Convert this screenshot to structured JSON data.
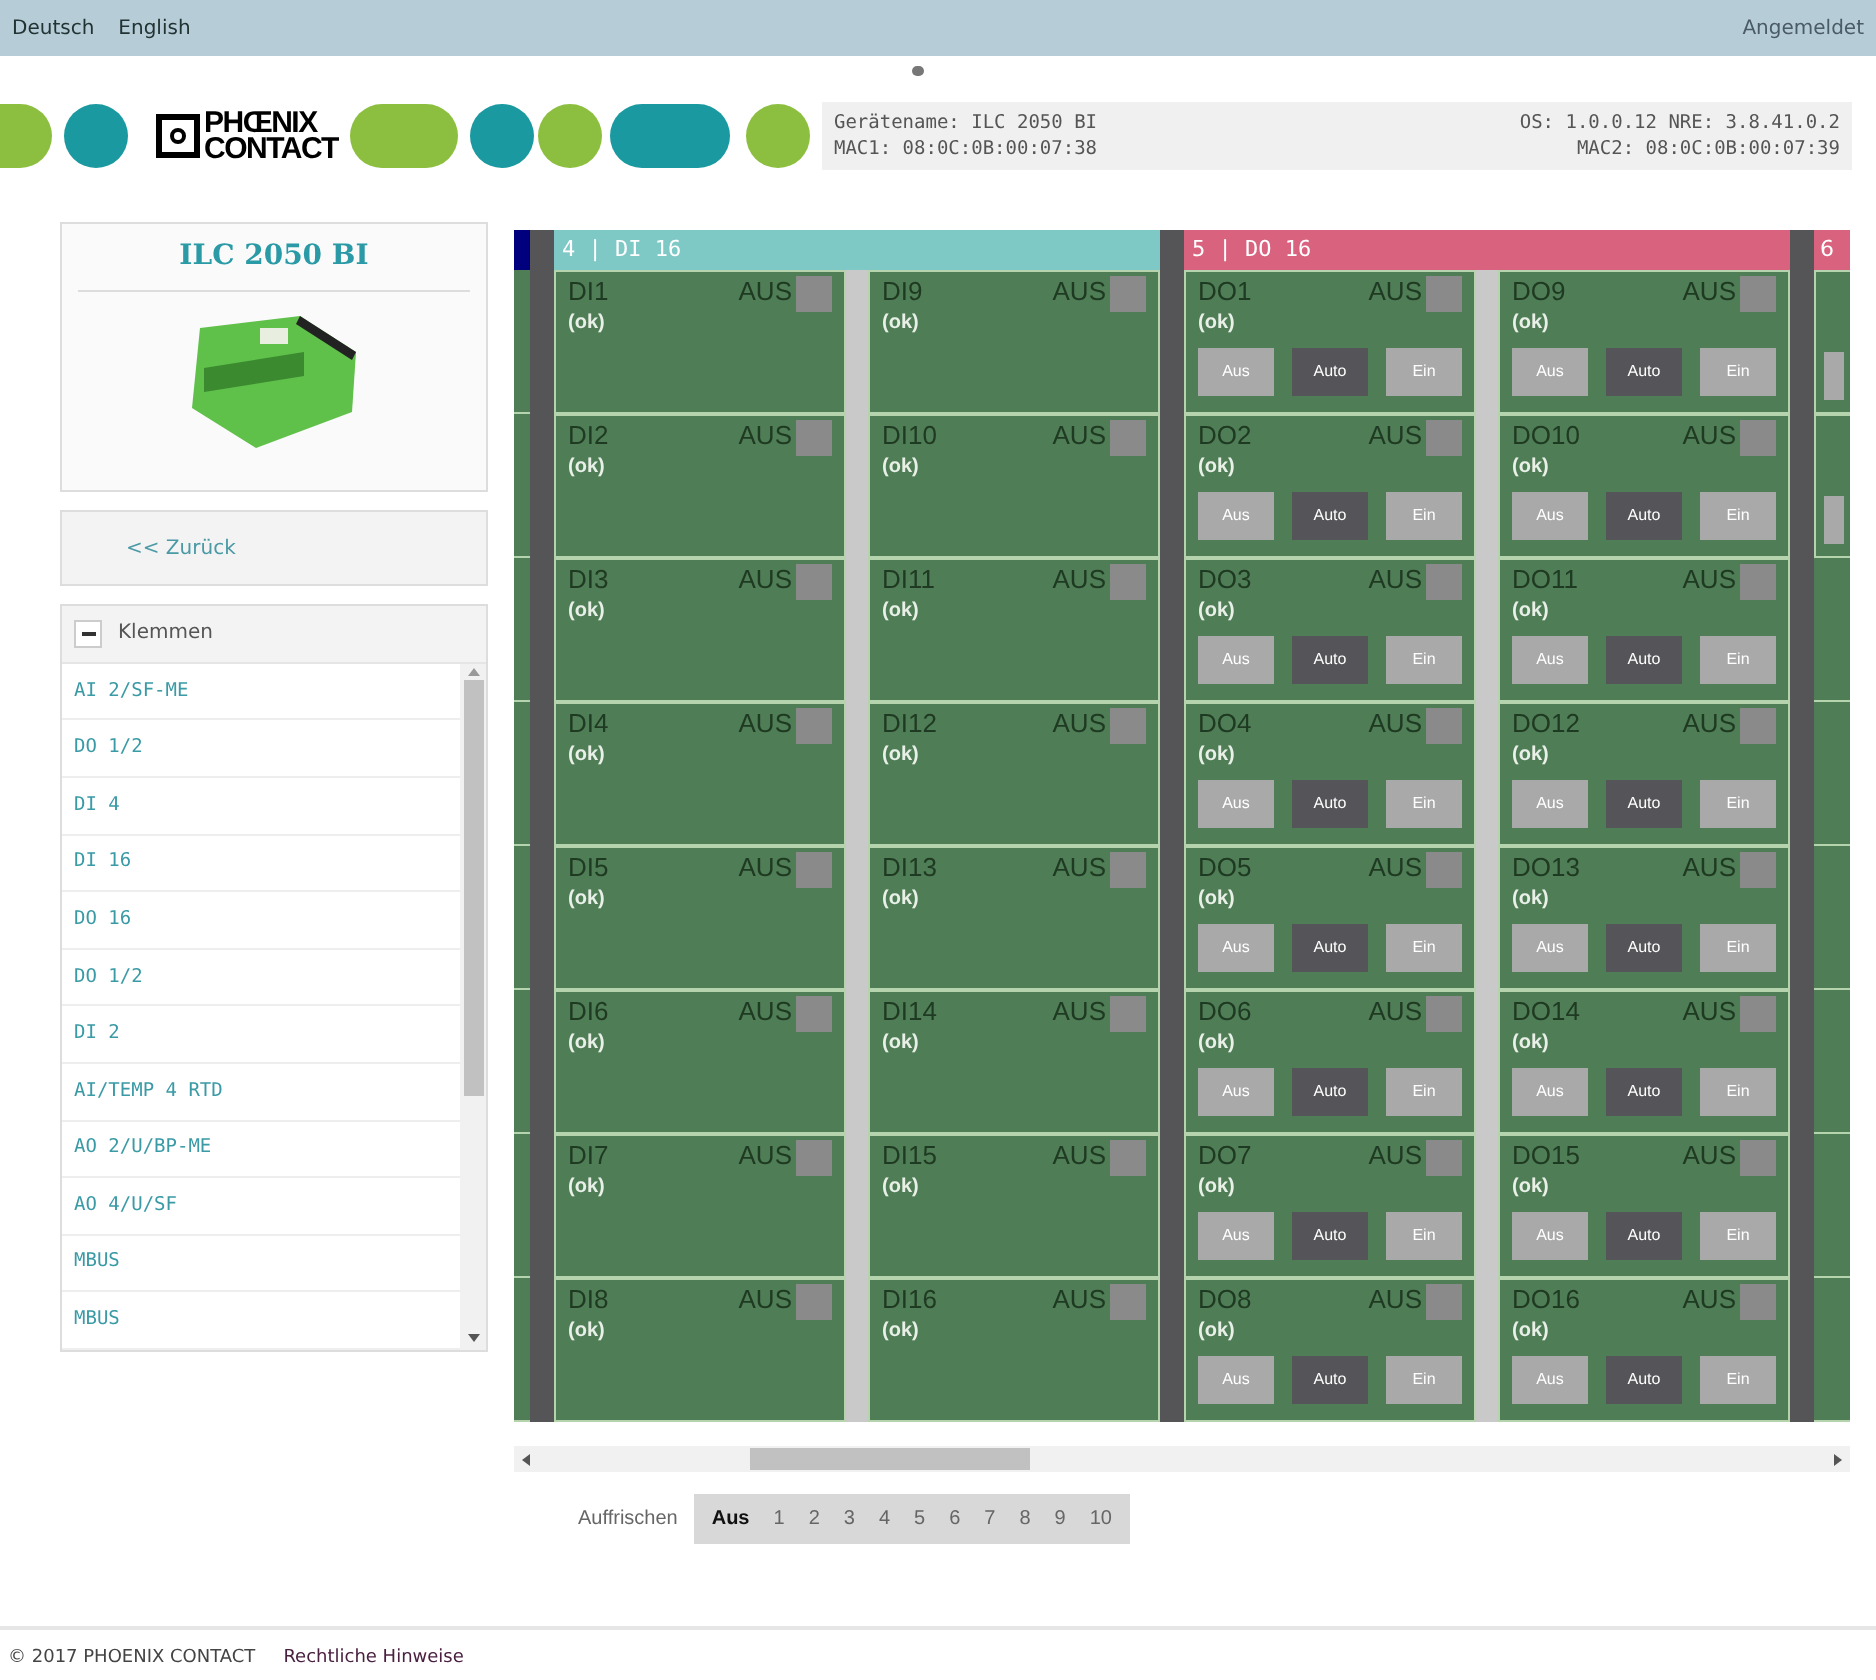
{
  "topbar": {
    "languages": [
      "Deutsch",
      "English"
    ],
    "status": "Angemeldet"
  },
  "header": {
    "logo": [
      "PHŒNIX",
      "CONTACT"
    ],
    "info_left": [
      "Gerätename: ILC 2050 BI",
      "MAC1: 08:0C:0B:00:07:38"
    ],
    "info_right": [
      "OS: 1.0.0.12 NRE: 3.8.41.0.2",
      "MAC2: 08:0C:0B:00:07:39"
    ]
  },
  "device": {
    "title": "ILC 2050 BI"
  },
  "back": "<< Zurück",
  "klemmen": {
    "title": "Klemmen",
    "expanded": true,
    "items": [
      "AI 2/SF-ME",
      "DO 1/2",
      "DI 4",
      "DI 16",
      "DO 16",
      "DO 1/2",
      "DI 2",
      "AI/TEMP 4 RTD",
      "AO 2/U/BP-ME",
      "AO 4/U/SF",
      "MBUS",
      "MBUS"
    ]
  },
  "modules": [
    {
      "kind": "input",
      "color": "#00007f"
    },
    {
      "kind": "input",
      "color": "#7ec8c6",
      "title": "4 | DI 16",
      "channels": [
        {
          "name": "DI1",
          "state": "AUS",
          "on": false,
          "status": "(ok)"
        },
        {
          "name": "DI2",
          "state": "AUS",
          "on": false,
          "status": "(ok)"
        },
        {
          "name": "DI3",
          "state": "AUS",
          "on": false,
          "status": "(ok)"
        },
        {
          "name": "DI4",
          "state": "AUS",
          "on": false,
          "status": "(ok)"
        },
        {
          "name": "DI5",
          "state": "AUS",
          "on": false,
          "status": "(ok)"
        },
        {
          "name": "DI6",
          "state": "AUS",
          "on": false,
          "status": "(ok)"
        },
        {
          "name": "DI7",
          "state": "AUS",
          "on": false,
          "status": "(ok)"
        },
        {
          "name": "DI8",
          "state": "AUS",
          "on": false,
          "status": "(ok)"
        },
        {
          "name": "DI9",
          "state": "AUS",
          "on": false,
          "status": "(ok)"
        },
        {
          "name": "DI10",
          "state": "AUS",
          "on": false,
          "status": "(ok)"
        },
        {
          "name": "DI11",
          "state": "AUS",
          "on": false,
          "status": "(ok)"
        },
        {
          "name": "DI12",
          "state": "AUS",
          "on": false,
          "status": "(ok)"
        },
        {
          "name": "DI13",
          "state": "AUS",
          "on": false,
          "status": "(ok)"
        },
        {
          "name": "DI14",
          "state": "AUS",
          "on": false,
          "status": "(ok)"
        },
        {
          "name": "DI15",
          "state": "AUS",
          "on": false,
          "status": "(ok)"
        },
        {
          "name": "DI16",
          "state": "AUS",
          "on": false,
          "status": "(ok)"
        }
      ]
    },
    {
      "kind": "output",
      "color": "#d9637f",
      "title": "5 | DO 16",
      "channels": [
        {
          "name": "DO1",
          "state": "AUS",
          "on": false,
          "status": "(ok)",
          "modes": [
            {
              "label": "Aus",
              "selected": false
            },
            {
              "label": "Auto",
              "selected": true
            },
            {
              "label": "Ein",
              "selected": false
            }
          ]
        },
        {
          "name": "DO2",
          "state": "AUS",
          "on": false,
          "status": "(ok)",
          "modes": [
            {
              "label": "Aus",
              "selected": false
            },
            {
              "label": "Auto",
              "selected": true
            },
            {
              "label": "Ein",
              "selected": false
            }
          ]
        },
        {
          "name": "DO3",
          "state": "AUS",
          "on": false,
          "status": "(ok)",
          "modes": [
            {
              "label": "Aus",
              "selected": false
            },
            {
              "label": "Auto",
              "selected": true
            },
            {
              "label": "Ein",
              "selected": false
            }
          ]
        },
        {
          "name": "DO4",
          "state": "AUS",
          "on": false,
          "status": "(ok)",
          "modes": [
            {
              "label": "Aus",
              "selected": false
            },
            {
              "label": "Auto",
              "selected": true
            },
            {
              "label": "Ein",
              "selected": false
            }
          ]
        },
        {
          "name": "DO5",
          "state": "AUS",
          "on": false,
          "status": "(ok)",
          "modes": [
            {
              "label": "Aus",
              "selected": false
            },
            {
              "label": "Auto",
              "selected": true
            },
            {
              "label": "Ein",
              "selected": false
            }
          ]
        },
        {
          "name": "DO6",
          "state": "AUS",
          "on": false,
          "status": "(ok)",
          "modes": [
            {
              "label": "Aus",
              "selected": false
            },
            {
              "label": "Auto",
              "selected": true
            },
            {
              "label": "Ein",
              "selected": false
            }
          ]
        },
        {
          "name": "DO7",
          "state": "AUS",
          "on": false,
          "status": "(ok)",
          "modes": [
            {
              "label": "Aus",
              "selected": false
            },
            {
              "label": "Auto",
              "selected": true
            },
            {
              "label": "Ein",
              "selected": false
            }
          ]
        },
        {
          "name": "DO8",
          "state": "AUS",
          "on": false,
          "status": "(ok)",
          "modes": [
            {
              "label": "Aus",
              "selected": false
            },
            {
              "label": "Auto",
              "selected": true
            },
            {
              "label": "Ein",
              "selected": false
            }
          ]
        },
        {
          "name": "DO9",
          "state": "AUS",
          "on": false,
          "status": "(ok)",
          "modes": [
            {
              "label": "Aus",
              "selected": false
            },
            {
              "label": "Auto",
              "selected": true
            },
            {
              "label": "Ein",
              "selected": false
            }
          ]
        },
        {
          "name": "DO10",
          "state": "AUS",
          "on": false,
          "status": "(ok)",
          "modes": [
            {
              "label": "Aus",
              "selected": false
            },
            {
              "label": "Auto",
              "selected": true
            },
            {
              "label": "Ein",
              "selected": false
            }
          ]
        },
        {
          "name": "DO11",
          "state": "AUS",
          "on": false,
          "status": "(ok)",
          "modes": [
            {
              "label": "Aus",
              "selected": false
            },
            {
              "label": "Auto",
              "selected": true
            },
            {
              "label": "Ein",
              "selected": false
            }
          ]
        },
        {
          "name": "DO12",
          "state": "AUS",
          "on": false,
          "status": "(ok)",
          "modes": [
            {
              "label": "Aus",
              "selected": false
            },
            {
              "label": "Auto",
              "selected": true
            },
            {
              "label": "Ein",
              "selected": false
            }
          ]
        },
        {
          "name": "DO13",
          "state": "AUS",
          "on": false,
          "status": "(ok)",
          "modes": [
            {
              "label": "Aus",
              "selected": false
            },
            {
              "label": "Auto",
              "selected": true
            },
            {
              "label": "Ein",
              "selected": false
            }
          ]
        },
        {
          "name": "DO14",
          "state": "AUS",
          "on": false,
          "status": "(ok)",
          "modes": [
            {
              "label": "Aus",
              "selected": false
            },
            {
              "label": "Auto",
              "selected": true
            },
            {
              "label": "Ein",
              "selected": false
            }
          ]
        },
        {
          "name": "DO15",
          "state": "AUS",
          "on": false,
          "status": "(ok)",
          "modes": [
            {
              "label": "Aus",
              "selected": false
            },
            {
              "label": "Auto",
              "selected": true
            },
            {
              "label": "Ein",
              "selected": false
            }
          ]
        },
        {
          "name": "DO16",
          "state": "AUS",
          "on": false,
          "status": "(ok)",
          "modes": [
            {
              "label": "Aus",
              "selected": false
            },
            {
              "label": "Auto",
              "selected": true
            },
            {
              "label": "Ein",
              "selected": false
            }
          ]
        }
      ]
    },
    {
      "kind": "output",
      "color": "#d9637f",
      "title": "6"
    }
  ],
  "refresh": {
    "label": "Auffrischen",
    "options": [
      {
        "label": "Aus",
        "selected": true
      },
      {
        "label": "1",
        "selected": false
      },
      {
        "label": "2",
        "selected": false
      },
      {
        "label": "3",
        "selected": false
      },
      {
        "label": "4",
        "selected": false
      },
      {
        "label": "5",
        "selected": false
      },
      {
        "label": "6",
        "selected": false
      },
      {
        "label": "7",
        "selected": false
      },
      {
        "label": "8",
        "selected": false
      },
      {
        "label": "9",
        "selected": false
      },
      {
        "label": "10",
        "selected": false
      }
    ]
  },
  "footer": {
    "copyright": "© 2017 PHOENIX CONTACT",
    "link": "Rechtliche Hinweise"
  }
}
